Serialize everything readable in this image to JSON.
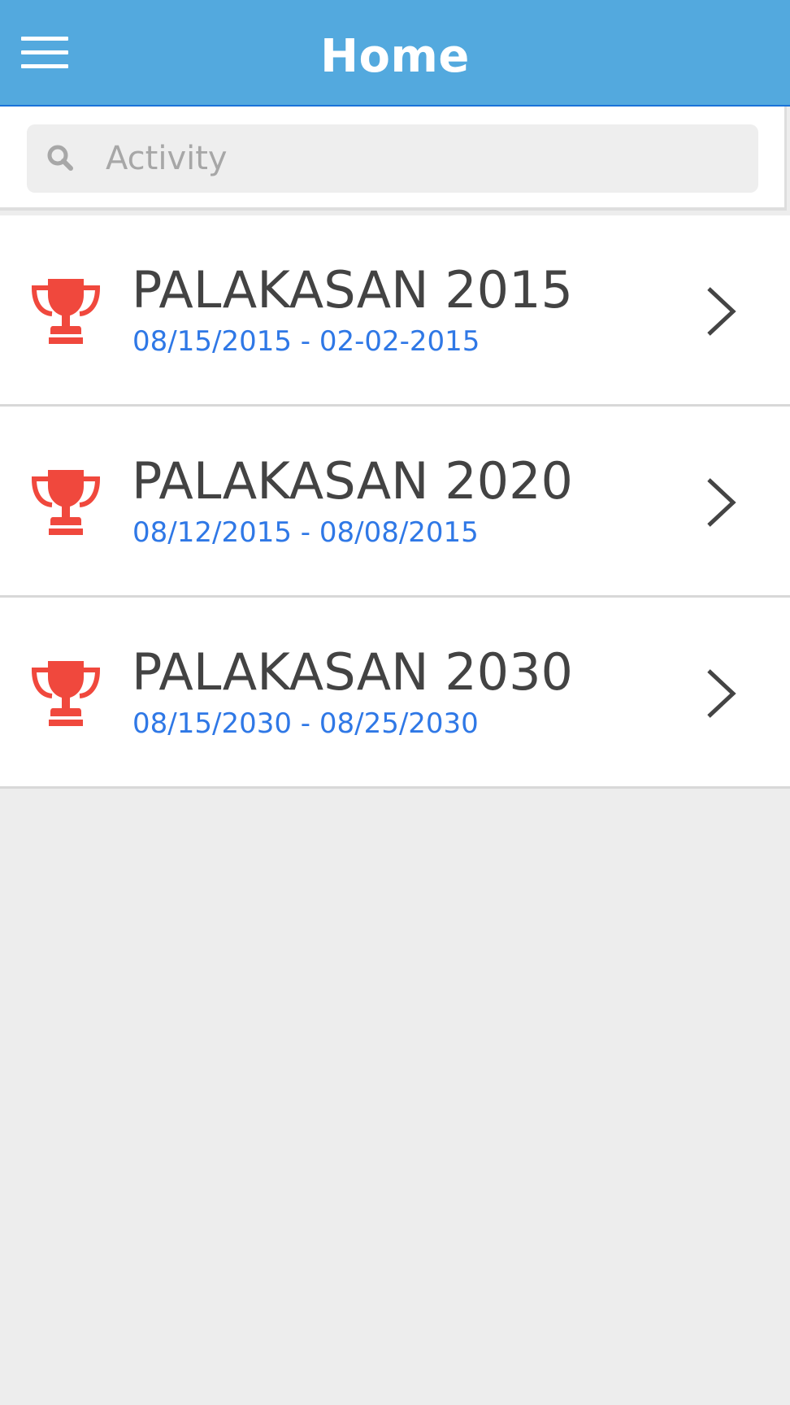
{
  "header": {
    "title": "Home",
    "menu_icon": "hamburger-menu-icon",
    "background_color": "#53a9de"
  },
  "search": {
    "placeholder": "Activity",
    "value": "",
    "icon": "search-icon"
  },
  "activities": [
    {
      "title": "PALAKASAN 2015",
      "dates": "08/15/2015 - 02-02-2015",
      "icon": "trophy-icon"
    },
    {
      "title": "PALAKASAN 2020",
      "dates": "08/12/2015 - 08/08/2015",
      "icon": "trophy-icon"
    },
    {
      "title": "PALAKASAN 2030",
      "dates": "08/15/2030 - 08/25/2030",
      "icon": "trophy-icon"
    }
  ],
  "colors": {
    "trophy": "#f0483d",
    "date_text": "#2f78e6",
    "title_text": "#434343",
    "background": "#ededed"
  }
}
